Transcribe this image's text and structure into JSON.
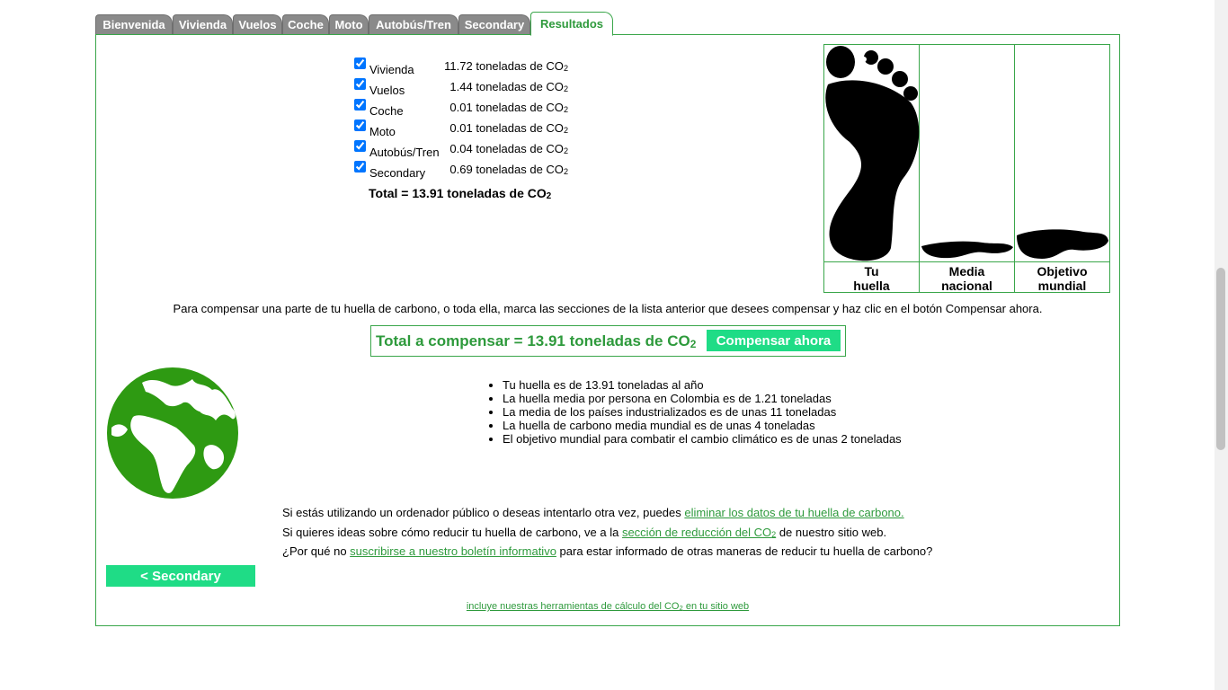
{
  "tabs": [
    "Bienvenida",
    "Vivienda",
    "Vuelos",
    "Coche",
    "Moto",
    "Autobús/Tren",
    "Secondary",
    "Resultados"
  ],
  "active_tab": "Resultados",
  "results": [
    {
      "label": "Vivienda",
      "value": "11.72",
      "checked": true
    },
    {
      "label": "Vuelos",
      "value": "1.44",
      "checked": true
    },
    {
      "label": "Coche",
      "value": "0.01",
      "checked": true
    },
    {
      "label": "Moto",
      "value": "0.01",
      "checked": true
    },
    {
      "label": "Autobús/Tren",
      "value": "0.04",
      "checked": true
    },
    {
      "label": "Secondary",
      "value": "0.69",
      "checked": true
    }
  ],
  "unit_text": "toneladas de CO",
  "sub2": "2",
  "total": {
    "prefix": "Total = ",
    "value": "13.91",
    "unit": " toneladas de CO"
  },
  "comparison": [
    {
      "line1": "Tu",
      "line2": "huella",
      "relative": 1.0
    },
    {
      "line1": "Media",
      "line2": "nacional",
      "relative": 0.09
    },
    {
      "line1": "Objetivo",
      "line2": "mundial",
      "relative": 0.14
    }
  ],
  "instruction": "Para compensar una parte de tu huella de carbono, o toda ella, marca las secciones de la lista anterior que desees compensar y haz clic en el botón Compensar ahora.",
  "compensate": {
    "text": "Total a compensar = 13.91 toneladas de CO",
    "button": "Compensar ahora"
  },
  "facts": [
    "Tu huella es de 13.91 toneladas al año",
    "La huella media por persona en Colombia es de 1.21 toneladas",
    "La media de los países industrializados es de unas 11 toneladas",
    "La huella de carbono media mundial es de unas 4 toneladas",
    "El objetivo mundial para combatir el cambio climático es de unas 2 toneladas"
  ],
  "links": {
    "l1_pre": "Si estás utilizando un ordenador público o deseas intentarlo otra vez, puedes ",
    "l1_link": "eliminar los datos de tu huella de carbono.",
    "l2_pre": "Si quieres ideas sobre cómo reducir tu huella de carbono, ve a la ",
    "l2_link": "sección de reducción del CO",
    "l2_post": " de nuestro sitio web.",
    "l3_pre": "¿Por qué no ",
    "l3_link": "suscribirse a nuestro boletín informativo",
    "l3_post": " para estar informado de otras maneras de reducir tu huella de carbono?"
  },
  "back_button": "< Secondary",
  "footer": {
    "pre": "incluye nuestras herramientas de cálculo del CO",
    "post": " en tu sitio web"
  },
  "colors": {
    "accent": "#2e9a3c",
    "button": "#1fdc86",
    "globe": "#2e9a12",
    "tab_inactive": "#8a8a8a"
  }
}
